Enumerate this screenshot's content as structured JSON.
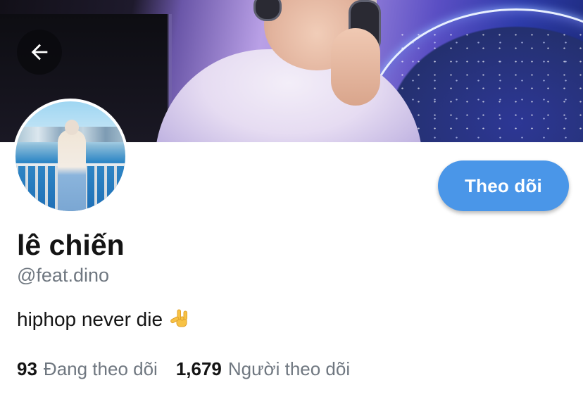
{
  "header": {
    "back_icon": "arrow-left-icon"
  },
  "profile": {
    "display_name": "lê chiến",
    "handle": "@feat.dino",
    "bio": "hiphop never die",
    "bio_emoji": "love-you-gesture-icon",
    "follow_label": "Theo dõi"
  },
  "stats": {
    "following_count": "93",
    "following_label": "Đang theo dõi",
    "followers_count": "1,679",
    "followers_label": "Người theo dõi"
  },
  "colors": {
    "accent": "#4a96e8",
    "text_primary": "#141414",
    "text_secondary": "#6f7780"
  }
}
